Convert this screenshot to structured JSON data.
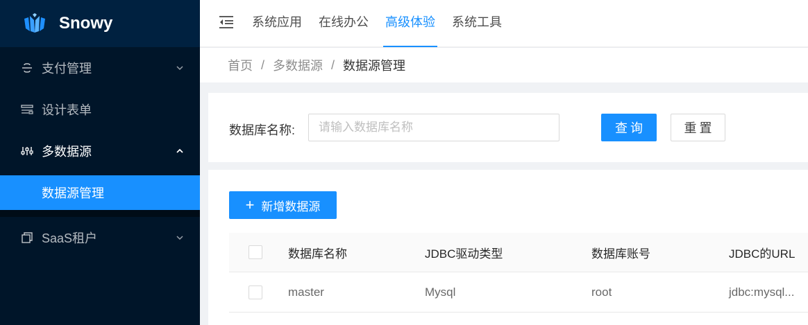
{
  "app": {
    "name": "Snowy"
  },
  "sidebar": {
    "items": [
      {
        "label": "支付管理",
        "icon": "strikethrough-icon",
        "has_children": true,
        "expanded": false
      },
      {
        "label": "设计表单",
        "icon": "form-icon",
        "has_children": false
      },
      {
        "label": "多数据源",
        "icon": "sliders-icon",
        "has_children": true,
        "expanded": true,
        "children": [
          {
            "label": "数据源管理",
            "selected": true
          }
        ]
      },
      {
        "label": "SaaS租户",
        "icon": "block-icon",
        "has_children": true,
        "expanded": false
      }
    ]
  },
  "topnav": {
    "items": [
      {
        "label": "系统应用"
      },
      {
        "label": "在线办公"
      },
      {
        "label": "高级体验",
        "active": true
      },
      {
        "label": "系统工具"
      }
    ]
  },
  "breadcrumb": {
    "items": [
      "首页",
      "多数据源",
      "数据源管理"
    ]
  },
  "search": {
    "label": "数据库名称:",
    "placeholder": "请输入数据库名称",
    "query_button": "查询",
    "reset_button": "重置"
  },
  "table": {
    "add_button": "新增数据源",
    "columns": [
      "数据库名称",
      "JDBC驱动类型",
      "数据库账号",
      "JDBC的URL"
    ],
    "rows": [
      [
        "master",
        "Mysql",
        "root",
        "jdbc:mysql..."
      ]
    ]
  },
  "colors": {
    "primary": "#1890ff",
    "sidebar": "#001529",
    "sidebar_logo": "#002140"
  }
}
